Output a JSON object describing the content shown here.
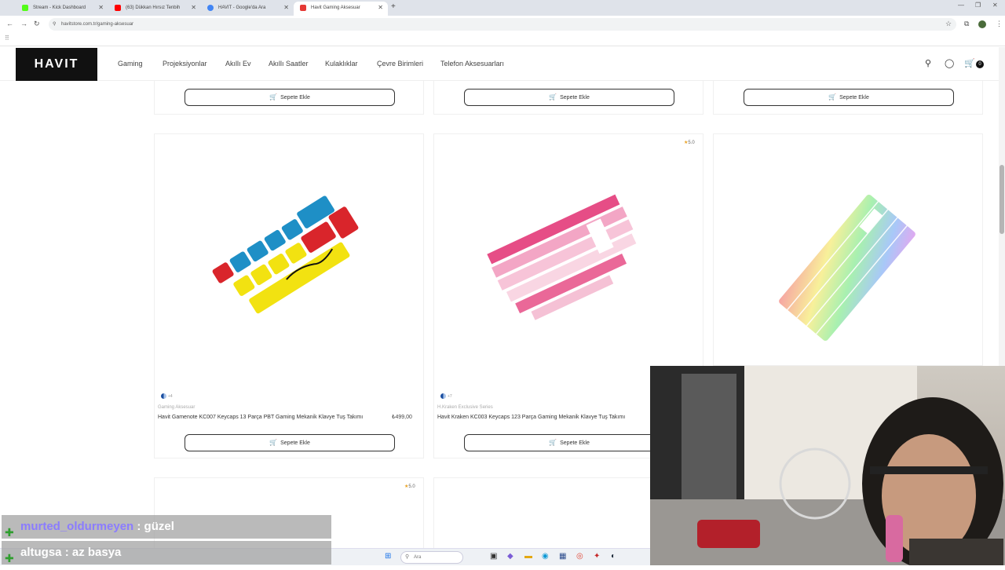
{
  "browser": {
    "tabs": [
      {
        "title": "Stream - Kick Dashboard",
        "color": "#53fc18"
      },
      {
        "title": "(63) Dükkan Hırsız Tenbih",
        "color": "#ff0000"
      },
      {
        "title": "HAVIT - Google'da Ara",
        "color": "#4285f4"
      },
      {
        "title": "Havit Gaming Aksesuar",
        "color": "#e53935"
      }
    ],
    "url": "havitstore.com.tr/gaming-aksesuar"
  },
  "site": {
    "logo": "HAVIT",
    "menu": [
      "Gaming",
      "Projeksiyonlar",
      "Akıllı Ev",
      "Akıllı Saatler",
      "Kulaklıklar",
      "Çevre Birimleri",
      "Telefon Aksesuarları"
    ],
    "cart_count": "0"
  },
  "buttons": {
    "add_to_cart": "Sepete Ekle"
  },
  "products": [
    {
      "swatch_count": "4",
      "category": "Gaming Aksesuar",
      "name": "Havit Gamenote KC007 Keycaps 13 Parça PBT Gaming Mekanik Klavye Tuş Takımı",
      "price": "₺499,00"
    },
    {
      "rating": "5.0",
      "swatch_count": "7",
      "category": "H.Kraken Exclusive Series",
      "name": "Havit Kraken KC003 Keycaps 123 Parça Gaming Mekanik Klavye Tuş Takımı"
    },
    {}
  ],
  "next_row": {
    "rating": "5.0"
  },
  "chat": [
    {
      "user": "murted_oldurmeyen",
      "message": ": güzel",
      "user_color": "#8b7cff"
    },
    {
      "user": "altugsa",
      "message": ": az basya",
      "user_color": "#ffffff"
    }
  ],
  "taskbar": {
    "search_placeholder": "Ara"
  },
  "icons": [
    "back-icon",
    "forward-icon",
    "reload-icon",
    "search-icon",
    "user-icon",
    "cart-icon",
    "windows-icon"
  ]
}
